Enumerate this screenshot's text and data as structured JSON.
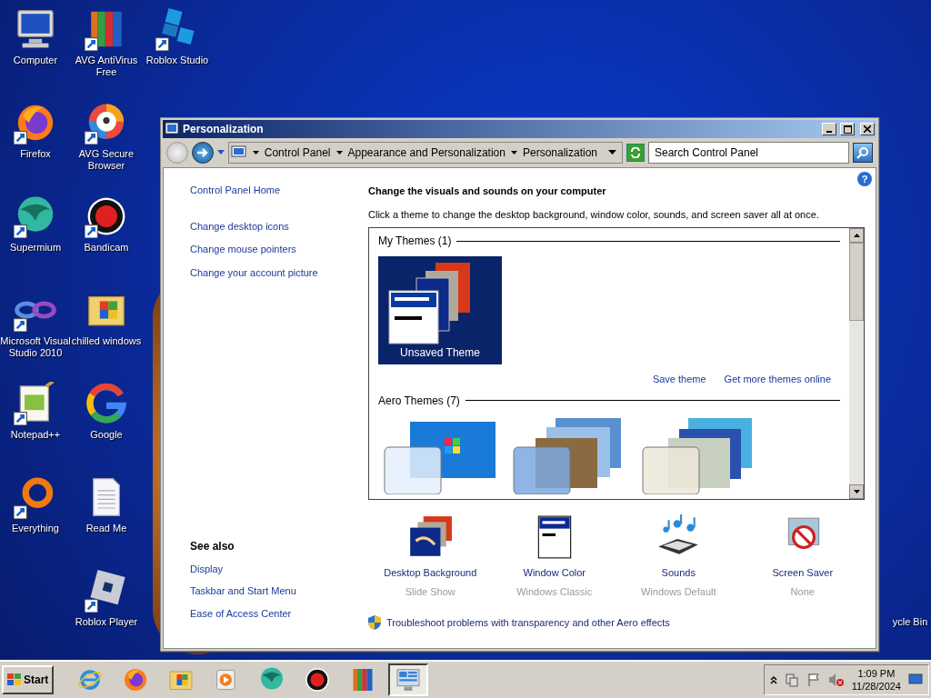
{
  "desktop_columns": [
    [
      {
        "label": "Computer",
        "kind": "computer"
      },
      {
        "label": "Firefox",
        "kind": "firefox"
      },
      {
        "label": "Supermium",
        "kind": "supermium"
      },
      {
        "label": "Microsoft Visual Studio 2010",
        "kind": "vs"
      },
      {
        "label": "Notepad++",
        "kind": "notepad"
      },
      {
        "label": "Everything",
        "kind": "everything"
      }
    ],
    [
      {
        "label": "AVG AntiVirus Free",
        "kind": "avg"
      },
      {
        "label": "AVG Secure Browser",
        "kind": "avg-browser"
      },
      {
        "label": "Bandicam",
        "kind": "bandicam"
      },
      {
        "label": "chilled windows",
        "kind": "folder"
      },
      {
        "label": "Google",
        "kind": "google"
      },
      {
        "label": "Read Me",
        "kind": "document"
      },
      {
        "label": "Roblox Player",
        "kind": "roblox-player"
      }
    ],
    [
      {
        "label": "Roblox Studio",
        "kind": "roblox-studio"
      }
    ]
  ],
  "recycle_bin": {
    "label": "ycle Bin"
  },
  "window": {
    "title": "Personalization",
    "help": "?",
    "address": [
      "Control Panel",
      "Appearance and Personalization",
      "Personalization"
    ],
    "search": {
      "placeholder": "Search Control Panel"
    },
    "sidebar": {
      "links": [
        "Control Panel Home",
        "Change desktop icons",
        "Change mouse pointers",
        "Change your account picture"
      ],
      "see_also_title": "See also",
      "see_also": [
        "Display",
        "Taskbar and Start Menu",
        "Ease of Access Center"
      ]
    },
    "heading": "Change the visuals and sounds on your computer",
    "description": "Click a theme to change the desktop background, window color, sounds, and screen saver all at once.",
    "theme_groups": [
      {
        "title": "My Themes (1)",
        "themes": [
          {
            "name": "Unsaved Theme",
            "kind": "classic",
            "selected": true
          }
        ],
        "links": [
          "Save theme",
          "Get more themes online"
        ]
      },
      {
        "title": "Aero Themes (7)",
        "themes": [
          {
            "kind": "windows7",
            "selected": false
          },
          {
            "kind": "architecture",
            "selected": false
          },
          {
            "kind": "characters",
            "selected": false
          }
        ]
      }
    ],
    "settings": [
      {
        "label": "Desktop Background",
        "value": "Slide Show",
        "kind": "background"
      },
      {
        "label": "Window Color",
        "value": "Windows Classic",
        "kind": "color"
      },
      {
        "label": "Sounds",
        "value": "Windows Default",
        "kind": "sounds"
      },
      {
        "label": "Screen Saver",
        "value": "None",
        "kind": "screensaver"
      }
    ],
    "troubleshoot": "Troubleshoot problems with transparency and other Aero effects"
  },
  "taskbar": {
    "start": "Start",
    "items": [
      {
        "kind": "ie",
        "selected": false
      },
      {
        "kind": "firefox",
        "selected": false
      },
      {
        "kind": "folder",
        "selected": false
      },
      {
        "kind": "media",
        "selected": false
      },
      {
        "kind": "supermium",
        "selected": false
      },
      {
        "kind": "bandicam",
        "selected": false
      },
      {
        "kind": "avg",
        "selected": false
      },
      {
        "kind": "control-panel",
        "selected": true
      }
    ],
    "time": "1:09 PM",
    "date": "11/28/2024"
  }
}
